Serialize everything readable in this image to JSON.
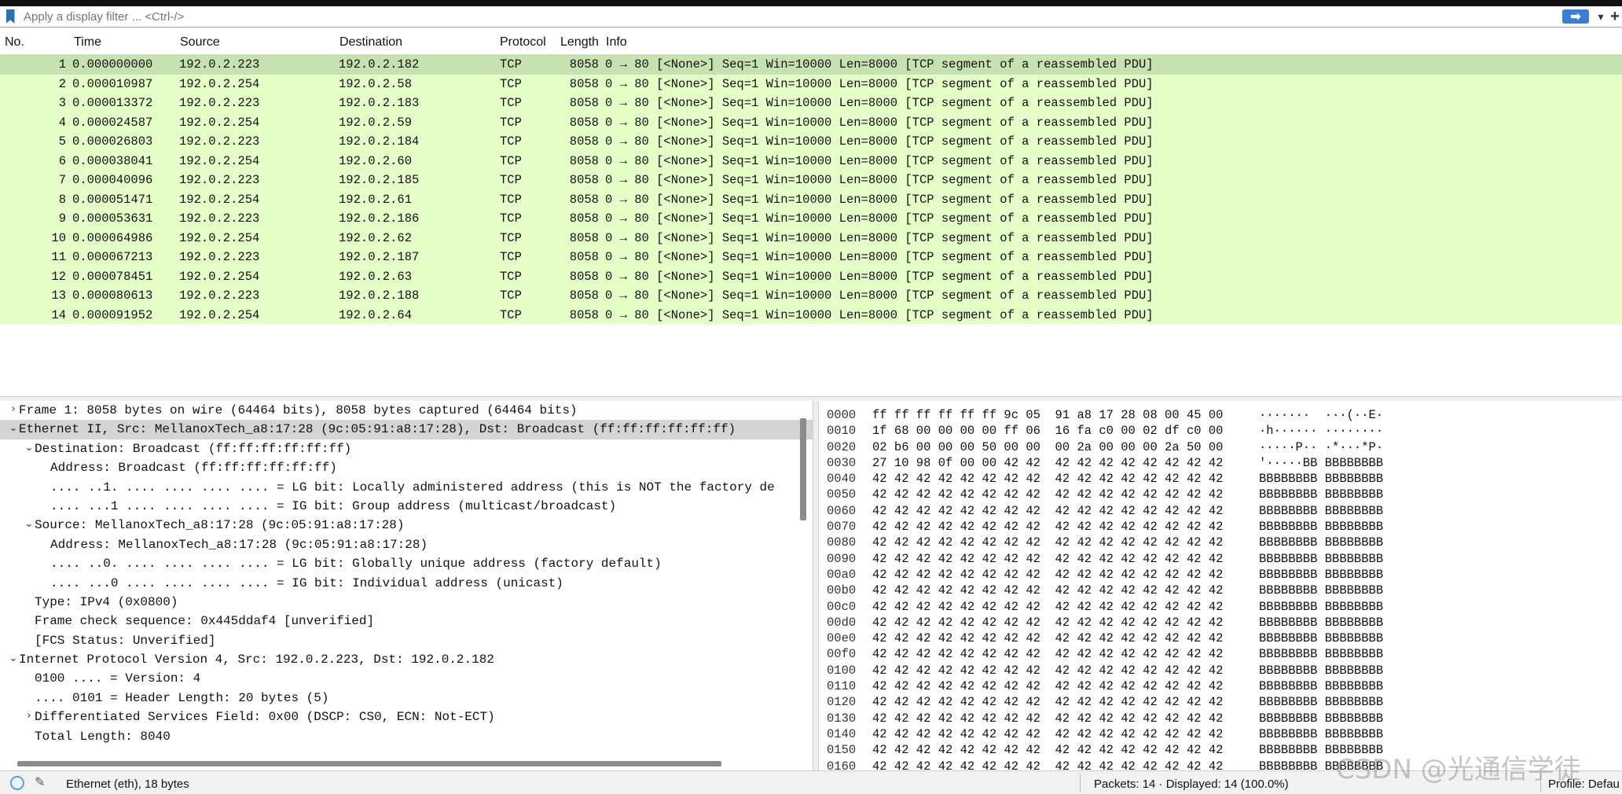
{
  "filter": {
    "placeholder": "Apply a display filter ... <Ctrl-/>"
  },
  "packet_list": {
    "columns": [
      "No.",
      "Time",
      "Source",
      "Destination",
      "Protocol",
      "Length",
      "Info"
    ],
    "rows": [
      {
        "no": "1",
        "time": "0.000000000",
        "src": "192.0.2.223",
        "dst": "192.0.2.182",
        "proto": "TCP",
        "len": "8058",
        "info": "0 → 80 [<None>] Seq=1 Win=10000 Len=8000 [TCP segment of a reassembled PDU]"
      },
      {
        "no": "2",
        "time": "0.000010987",
        "src": "192.0.2.254",
        "dst": "192.0.2.58",
        "proto": "TCP",
        "len": "8058",
        "info": "0 → 80 [<None>] Seq=1 Win=10000 Len=8000 [TCP segment of a reassembled PDU]"
      },
      {
        "no": "3",
        "time": "0.000013372",
        "src": "192.0.2.223",
        "dst": "192.0.2.183",
        "proto": "TCP",
        "len": "8058",
        "info": "0 → 80 [<None>] Seq=1 Win=10000 Len=8000 [TCP segment of a reassembled PDU]"
      },
      {
        "no": "4",
        "time": "0.000024587",
        "src": "192.0.2.254",
        "dst": "192.0.2.59",
        "proto": "TCP",
        "len": "8058",
        "info": "0 → 80 [<None>] Seq=1 Win=10000 Len=8000 [TCP segment of a reassembled PDU]"
      },
      {
        "no": "5",
        "time": "0.000026803",
        "src": "192.0.2.223",
        "dst": "192.0.2.184",
        "proto": "TCP",
        "len": "8058",
        "info": "0 → 80 [<None>] Seq=1 Win=10000 Len=8000 [TCP segment of a reassembled PDU]"
      },
      {
        "no": "6",
        "time": "0.000038041",
        "src": "192.0.2.254",
        "dst": "192.0.2.60",
        "proto": "TCP",
        "len": "8058",
        "info": "0 → 80 [<None>] Seq=1 Win=10000 Len=8000 [TCP segment of a reassembled PDU]"
      },
      {
        "no": "7",
        "time": "0.000040096",
        "src": "192.0.2.223",
        "dst": "192.0.2.185",
        "proto": "TCP",
        "len": "8058",
        "info": "0 → 80 [<None>] Seq=1 Win=10000 Len=8000 [TCP segment of a reassembled PDU]"
      },
      {
        "no": "8",
        "time": "0.000051471",
        "src": "192.0.2.254",
        "dst": "192.0.2.61",
        "proto": "TCP",
        "len": "8058",
        "info": "0 → 80 [<None>] Seq=1 Win=10000 Len=8000 [TCP segment of a reassembled PDU]"
      },
      {
        "no": "9",
        "time": "0.000053631",
        "src": "192.0.2.223",
        "dst": "192.0.2.186",
        "proto": "TCP",
        "len": "8058",
        "info": "0 → 80 [<None>] Seq=1 Win=10000 Len=8000 [TCP segment of a reassembled PDU]"
      },
      {
        "no": "10",
        "time": "0.000064986",
        "src": "192.0.2.254",
        "dst": "192.0.2.62",
        "proto": "TCP",
        "len": "8058",
        "info": "0 → 80 [<None>] Seq=1 Win=10000 Len=8000 [TCP segment of a reassembled PDU]"
      },
      {
        "no": "11",
        "time": "0.000067213",
        "src": "192.0.2.223",
        "dst": "192.0.2.187",
        "proto": "TCP",
        "len": "8058",
        "info": "0 → 80 [<None>] Seq=1 Win=10000 Len=8000 [TCP segment of a reassembled PDU]"
      },
      {
        "no": "12",
        "time": "0.000078451",
        "src": "192.0.2.254",
        "dst": "192.0.2.63",
        "proto": "TCP",
        "len": "8058",
        "info": "0 → 80 [<None>] Seq=1 Win=10000 Len=8000 [TCP segment of a reassembled PDU]"
      },
      {
        "no": "13",
        "time": "0.000080613",
        "src": "192.0.2.223",
        "dst": "192.0.2.188",
        "proto": "TCP",
        "len": "8058",
        "info": "0 → 80 [<None>] Seq=1 Win=10000 Len=8000 [TCP segment of a reassembled PDU]"
      },
      {
        "no": "14",
        "time": "0.000091952",
        "src": "192.0.2.254",
        "dst": "192.0.2.64",
        "proto": "TCP",
        "len": "8058",
        "info": "0 → 80 [<None>] Seq=1 Win=10000 Len=8000 [TCP segment of a reassembled PDU]"
      }
    ]
  },
  "details": [
    {
      "twisty": "›",
      "text": "Frame 1: 8058 bytes on wire (64464 bits), 8058 bytes captured (64464 bits)"
    },
    {
      "twisty": "⌄",
      "text": "Ethernet II, Src: MellanoxTech_a8:17:28 (9c:05:91:a8:17:28), Dst: Broadcast (ff:ff:ff:ff:ff:ff)"
    },
    {
      "twisty": "⌄",
      "text": "Destination: Broadcast (ff:ff:ff:ff:ff:ff)"
    },
    {
      "twisty": "",
      "text": "Address: Broadcast (ff:ff:ff:ff:ff:ff)"
    },
    {
      "twisty": "",
      "text": ".... ..1. .... .... .... .... = LG bit: Locally administered address (this is NOT the factory de"
    },
    {
      "twisty": "",
      "text": ".... ...1 .... .... .... .... = IG bit: Group address (multicast/broadcast)"
    },
    {
      "twisty": "⌄",
      "text": "Source: MellanoxTech_a8:17:28 (9c:05:91:a8:17:28)"
    },
    {
      "twisty": "",
      "text": "Address: MellanoxTech_a8:17:28 (9c:05:91:a8:17:28)"
    },
    {
      "twisty": "",
      "text": ".... ..0. .... .... .... .... = LG bit: Globally unique address (factory default)"
    },
    {
      "twisty": "",
      "text": ".... ...0 .... .... .... .... = IG bit: Individual address (unicast)"
    },
    {
      "twisty": "",
      "text": "Type: IPv4 (0x0800)"
    },
    {
      "twisty": "",
      "text": "Frame check sequence: 0x445ddaf4 [unverified]"
    },
    {
      "twisty": "",
      "text": "[FCS Status: Unverified]"
    },
    {
      "twisty": "⌄",
      "text": "Internet Protocol Version 4, Src: 192.0.2.223, Dst: 192.0.2.182"
    },
    {
      "twisty": "",
      "text": "0100 .... = Version: 4"
    },
    {
      "twisty": "",
      "text": ".... 0101 = Header Length: 20 bytes (5)"
    },
    {
      "twisty": "›",
      "text": "Differentiated Services Field: 0x00 (DSCP: CS0, ECN: Not-ECT)"
    },
    {
      "twisty": "",
      "text": "Total Length: 8040"
    }
  ],
  "bytes": [
    {
      "off": "0000",
      "hex": "ff ff ff ff ff ff 9c 05  91 a8 17 28 08 00 45 00",
      "ascii": "·······  ···(··E·"
    },
    {
      "off": "0010",
      "hex": "1f 68 00 00 00 00 ff 06  16 fa c0 00 02 df c0 00",
      "ascii": "·h······ ········"
    },
    {
      "off": "0020",
      "hex": "02 b6 00 00 00 50 00 00  00 2a 00 00 00 2a 50 00",
      "ascii": "·····P·· ·*···*P·"
    },
    {
      "off": "0030",
      "hex": "27 10 98 0f 00 00 42 42  42 42 42 42 42 42 42 42",
      "ascii": "'·····BB BBBBBBBB"
    },
    {
      "off": "0040",
      "hex": "42 42 42 42 42 42 42 42  42 42 42 42 42 42 42 42",
      "ascii": "BBBBBBBB BBBBBBBB"
    },
    {
      "off": "0050",
      "hex": "42 42 42 42 42 42 42 42  42 42 42 42 42 42 42 42",
      "ascii": "BBBBBBBB BBBBBBBB"
    },
    {
      "off": "0060",
      "hex": "42 42 42 42 42 42 42 42  42 42 42 42 42 42 42 42",
      "ascii": "BBBBBBBB BBBBBBBB"
    },
    {
      "off": "0070",
      "hex": "42 42 42 42 42 42 42 42  42 42 42 42 42 42 42 42",
      "ascii": "BBBBBBBB BBBBBBBB"
    },
    {
      "off": "0080",
      "hex": "42 42 42 42 42 42 42 42  42 42 42 42 42 42 42 42",
      "ascii": "BBBBBBBB BBBBBBBB"
    },
    {
      "off": "0090",
      "hex": "42 42 42 42 42 42 42 42  42 42 42 42 42 42 42 42",
      "ascii": "BBBBBBBB BBBBBBBB"
    },
    {
      "off": "00a0",
      "hex": "42 42 42 42 42 42 42 42  42 42 42 42 42 42 42 42",
      "ascii": "BBBBBBBB BBBBBBBB"
    },
    {
      "off": "00b0",
      "hex": "42 42 42 42 42 42 42 42  42 42 42 42 42 42 42 42",
      "ascii": "BBBBBBBB BBBBBBBB"
    },
    {
      "off": "00c0",
      "hex": "42 42 42 42 42 42 42 42  42 42 42 42 42 42 42 42",
      "ascii": "BBBBBBBB BBBBBBBB"
    },
    {
      "off": "00d0",
      "hex": "42 42 42 42 42 42 42 42  42 42 42 42 42 42 42 42",
      "ascii": "BBBBBBBB BBBBBBBB"
    },
    {
      "off": "00e0",
      "hex": "42 42 42 42 42 42 42 42  42 42 42 42 42 42 42 42",
      "ascii": "BBBBBBBB BBBBBBBB"
    },
    {
      "off": "00f0",
      "hex": "42 42 42 42 42 42 42 42  42 42 42 42 42 42 42 42",
      "ascii": "BBBBBBBB BBBBBBBB"
    },
    {
      "off": "0100",
      "hex": "42 42 42 42 42 42 42 42  42 42 42 42 42 42 42 42",
      "ascii": "BBBBBBBB BBBBBBBB"
    },
    {
      "off": "0110",
      "hex": "42 42 42 42 42 42 42 42  42 42 42 42 42 42 42 42",
      "ascii": "BBBBBBBB BBBBBBBB"
    },
    {
      "off": "0120",
      "hex": "42 42 42 42 42 42 42 42  42 42 42 42 42 42 42 42",
      "ascii": "BBBBBBBB BBBBBBBB"
    },
    {
      "off": "0130",
      "hex": "42 42 42 42 42 42 42 42  42 42 42 42 42 42 42 42",
      "ascii": "BBBBBBBB BBBBBBBB"
    },
    {
      "off": "0140",
      "hex": "42 42 42 42 42 42 42 42  42 42 42 42 42 42 42 42",
      "ascii": "BBBBBBBB BBBBBBBB"
    },
    {
      "off": "0150",
      "hex": "42 42 42 42 42 42 42 42  42 42 42 42 42 42 42 42",
      "ascii": "BBBBBBBB BBBBBBBB"
    },
    {
      "off": "0160",
      "hex": "42 42 42 42 42 42 42 42  42 42 42 42 42 42 42 42",
      "ascii": "BBBBBBBB BBBBBBBB"
    }
  ],
  "status": {
    "field_info": "Ethernet (eth), 18 bytes",
    "packets": "Packets: 14 · Displayed: 14 (100.0%)",
    "profile": "Profile: Defau",
    "watermark": "CSDN @光通信学徒"
  }
}
